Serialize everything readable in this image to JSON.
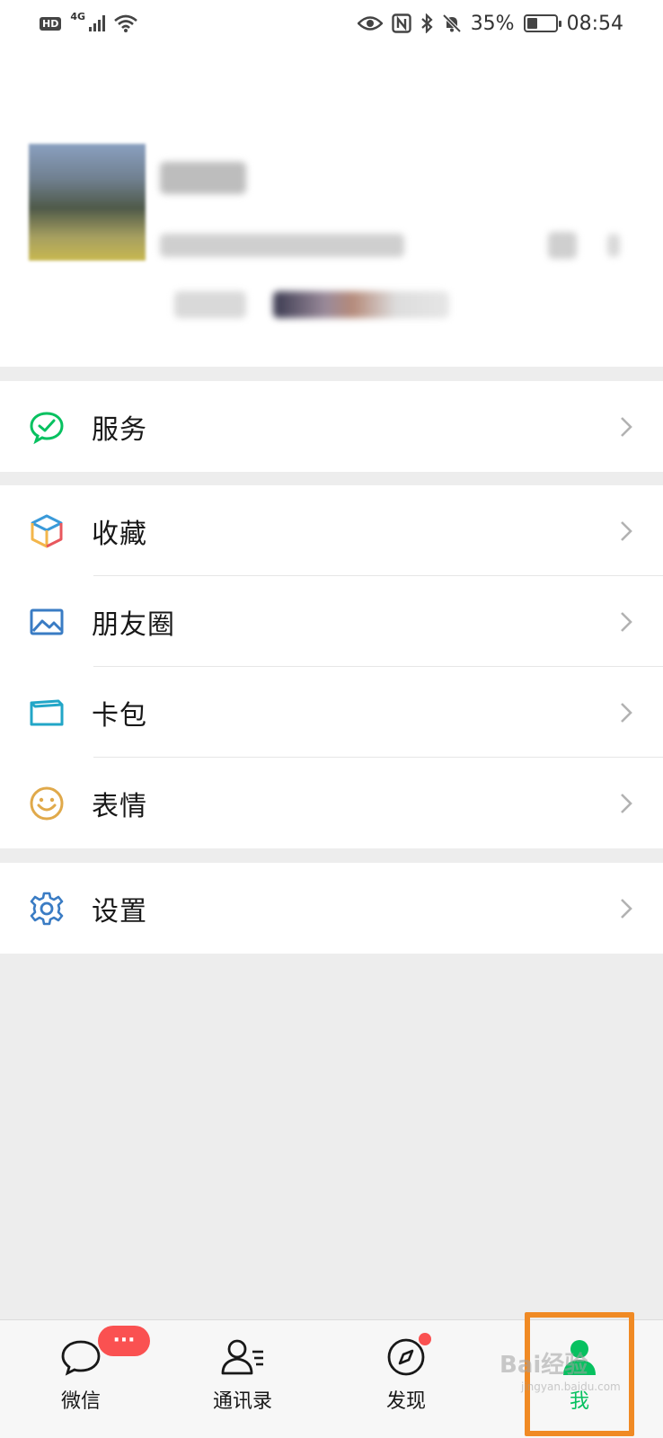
{
  "status_bar": {
    "hd": "HD",
    "network": "4G",
    "battery_percent": "35%",
    "battery_level": 0.35,
    "time": "08:54",
    "icons": [
      "eye-icon",
      "nfc-icon",
      "bluetooth-icon",
      "bell-off-icon",
      "battery-icon"
    ]
  },
  "profile": {
    "avatar": "avatar-image",
    "name_obscured": true
  },
  "menu": {
    "services": {
      "label": "服务",
      "icon": "wechat-pay-icon",
      "color": "#07c160"
    },
    "favorites": {
      "label": "收藏",
      "icon": "cube-icon"
    },
    "moments": {
      "label": "朋友圈",
      "icon": "picture-icon",
      "color": "#3a7cc4"
    },
    "cards": {
      "label": "卡包",
      "icon": "card-icon",
      "color": "#22a6c7"
    },
    "stickers": {
      "label": "表情",
      "icon": "smile-icon",
      "color": "#e0a94a"
    },
    "settings": {
      "label": "设置",
      "icon": "gear-icon",
      "color": "#3a7cc4"
    }
  },
  "tabbar": {
    "chats": {
      "label": "微信",
      "badge": "···"
    },
    "contacts": {
      "label": "通讯录"
    },
    "discover": {
      "label": "发现",
      "has_dot": true
    },
    "me": {
      "label": "我",
      "active": true
    }
  },
  "colors": {
    "accent": "#07c160",
    "badge": "#fa5151",
    "highlight": "#f08a24"
  },
  "watermark": {
    "text": "Bai经验",
    "sub": "jingyan.baidu.com"
  }
}
